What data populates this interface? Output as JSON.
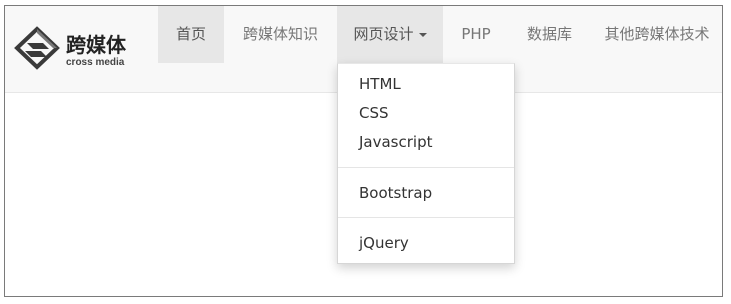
{
  "brand": {
    "name": "跨媒体",
    "subtitle": "cross media",
    "logo_icon": "diamond-logo-icon"
  },
  "nav": {
    "items": [
      {
        "label": "首页"
      },
      {
        "label": "跨媒体知识"
      },
      {
        "label": "网页设计"
      },
      {
        "label": "PHP"
      },
      {
        "label": "数据库"
      },
      {
        "label": "其他跨媒体技术"
      }
    ]
  },
  "dropdown": {
    "items": [
      {
        "label": "HTML"
      },
      {
        "label": "CSS"
      },
      {
        "label": "Javascript"
      },
      {
        "label": "Bootstrap"
      },
      {
        "label": "jQuery"
      }
    ]
  },
  "colors": {
    "navbar_bg": "#f8f8f8",
    "active_bg": "#e7e7e7",
    "nav_text": "#777777",
    "menu_text": "#333333"
  }
}
